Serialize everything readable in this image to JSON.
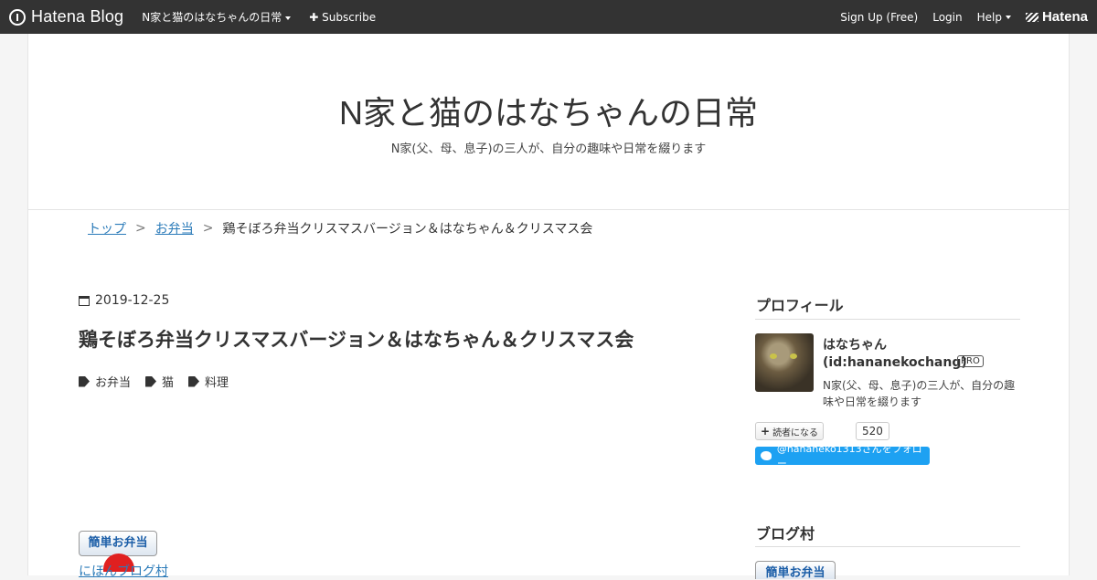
{
  "header": {
    "logo_text": "Hatena Blog",
    "blog_menu": "N家と猫のはなちゃんの日常",
    "subscribe": "Subscribe",
    "signup": "Sign Up (Free)",
    "login": "Login",
    "help": "Help",
    "brand": "Hatena"
  },
  "blog": {
    "title": "N家と猫のはなちゃんの日常",
    "description": "N家(父、母、息子)の三人が、自分の趣味や日常を綴ります"
  },
  "breadcrumb": {
    "top": "トップ",
    "category": "お弁当",
    "current": "鶏そぼろ弁当クリスマスバージョン＆はなちゃん＆クリスマス会",
    "sep": ">"
  },
  "entry": {
    "date": "2019-12-25",
    "title": "鶏そぼろ弁当クリスマスバージョン＆はなちゃん＆クリスマス会",
    "categories": [
      "お弁当",
      "猫",
      "料理"
    ],
    "badge": "簡単お弁当",
    "link": "にほんブログ村"
  },
  "sidebar": {
    "profile_heading": "プロフィール",
    "name": "はなちゃん",
    "id": "(id:hananekochang)",
    "pro": "PRO",
    "description": "N家(父、母、息子)の三人が、自分の趣味や日常を綴ります",
    "subscribe_label": "読者になる",
    "subscriber_count": "520",
    "twitter_follow": "@hananeko1313さんをフォロー",
    "blogmura_heading": "ブログ村",
    "blogmura_badge": "簡単お弁当"
  }
}
